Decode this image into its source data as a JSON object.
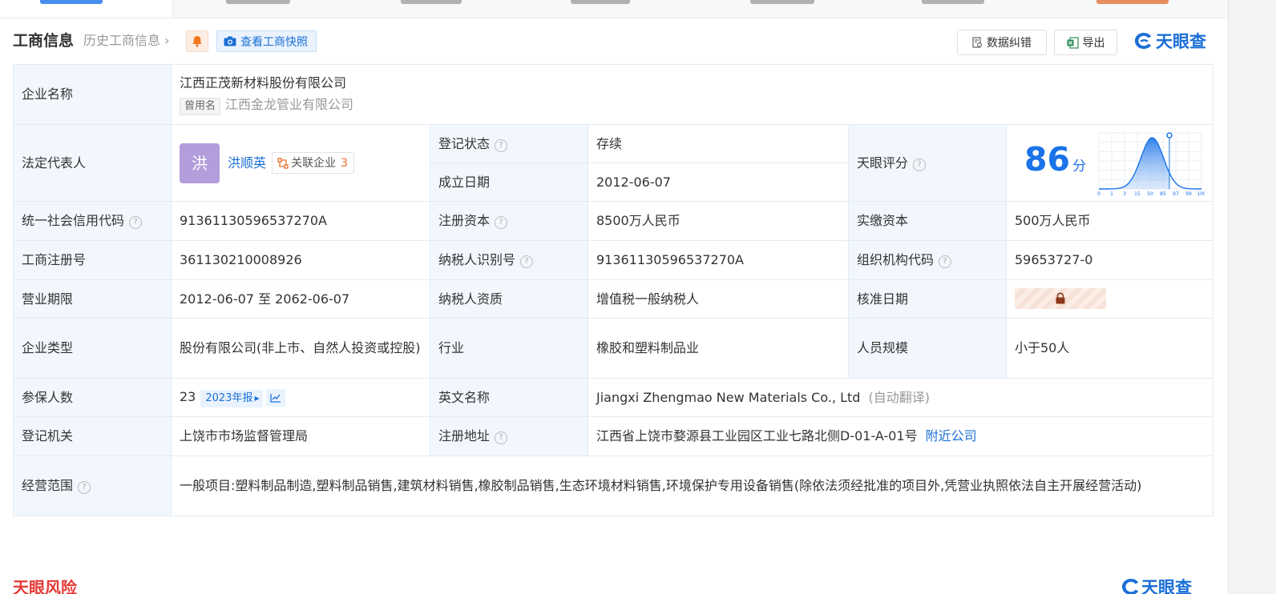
{
  "header": {
    "title": "工商信息",
    "history": "历史工商信息",
    "snapshot": "查看工商快照",
    "correct_btn": "数据纠错",
    "export_btn": "导出",
    "logo_text": "天眼查"
  },
  "company": {
    "name_label": "企业名称",
    "name": "江西正茂新材料股份有限公司",
    "former_tag": "曾用名",
    "former_name": "江西金龙管业有限公司"
  },
  "legal": {
    "label": "法定代表人",
    "avatar_char": "洪",
    "name": "洪顺英",
    "related_label": "关联企业",
    "related_count": "3"
  },
  "status": {
    "label": "登记状态",
    "value": "存续"
  },
  "founded": {
    "label": "成立日期",
    "value": "2012-06-07"
  },
  "score": {
    "label": "天眼评分",
    "value": "86",
    "unit": "分",
    "axis_ticks": [
      "0",
      "1",
      "3",
      "15",
      "50",
      "85",
      "97",
      "99",
      "100"
    ],
    "marker_at": 85
  },
  "credit_code": {
    "label": "统一社会信用代码",
    "value": "91361130596537270A"
  },
  "reg_capital": {
    "label": "注册资本",
    "value": "8500万人民币"
  },
  "paid_capital": {
    "label": "实缴资本",
    "value": "500万人民币"
  },
  "reg_no": {
    "label": "工商注册号",
    "value": "361130210008926"
  },
  "taxpayer_id": {
    "label": "纳税人识别号",
    "value": "91361130596537270A"
  },
  "org_code": {
    "label": "组织机构代码",
    "value": "59653727-0"
  },
  "term": {
    "label": "营业期限",
    "value": "2012-06-07 至 2062-06-07"
  },
  "taxpayer_qual": {
    "label": "纳税人资质",
    "value": "增值税一般纳税人"
  },
  "approve_date": {
    "label": "核准日期"
  },
  "company_type": {
    "label": "企业类型",
    "value": "股份有限公司(非上市、自然人投资或控股)"
  },
  "industry": {
    "label": "行业",
    "value": "橡胶和塑料制品业"
  },
  "staff": {
    "label": "人员规模",
    "value": "小于50人"
  },
  "insured": {
    "label": "参保人数",
    "value": "23",
    "report": "2023年报"
  },
  "english": {
    "label": "英文名称",
    "value": "Jiangxi Zhengmao New Materials Co., Ltd",
    "note": "(自动翻译)"
  },
  "authority": {
    "label": "登记机关",
    "value": "上饶市市场监督管理局"
  },
  "address": {
    "label": "注册地址",
    "value": "江西省上饶市婺源县工业园区工业七路北侧D-01-A-01号",
    "nearby": "附近公司"
  },
  "scope": {
    "label": "经营范围",
    "value": "一般项目:塑料制品制造,塑料制品销售,建筑材料销售,橡胶制品销售,生态环境材料销售,环境保护专用设备销售(除依法须经批准的项目外,凭营业执照依法自主开展经营活动)"
  },
  "section2": {
    "title": "天眼风险"
  },
  "colors": {
    "accent": "#1a73e8",
    "label_bg": "#f2f7fd",
    "status_green": "#20a162",
    "count_orange": "#e8702a"
  }
}
